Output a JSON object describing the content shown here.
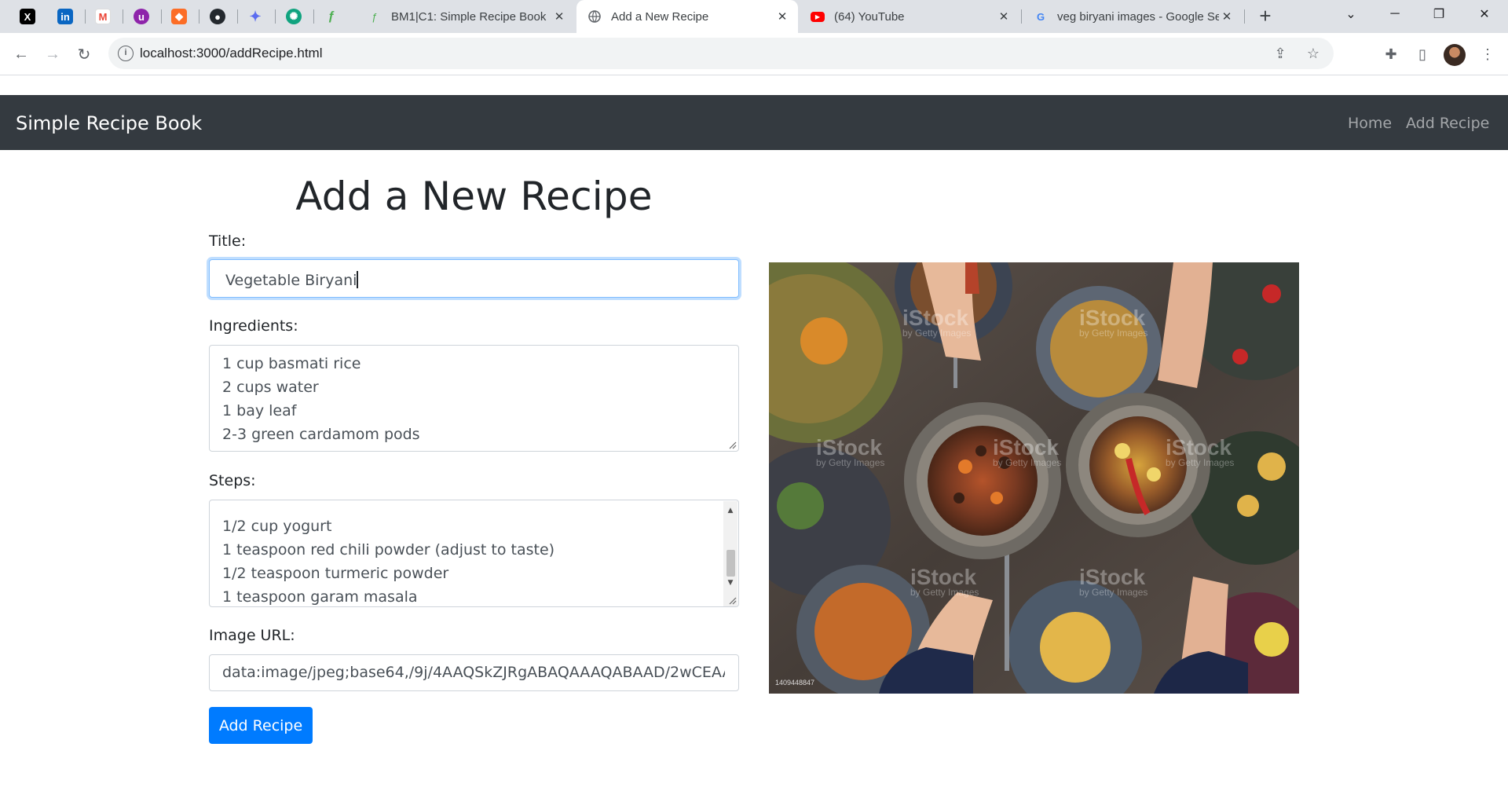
{
  "browser": {
    "tabs": [
      {
        "label": "BM1|C1: Simple Recipe Book"
      },
      {
        "label": "Add a New Recipe"
      },
      {
        "label": "(64) YouTube"
      },
      {
        "label": "veg biryani images - Google Se"
      }
    ],
    "address": "localhost:3000/addRecipe.html"
  },
  "navbar": {
    "brand": "Simple Recipe Book",
    "links": [
      "Home",
      "Add Recipe"
    ]
  },
  "form": {
    "heading": "Add a New Recipe",
    "title_label": "Title:",
    "title_value": "Vegetable Biryani",
    "ingredients_label": "Ingredients:",
    "ingredients_lines": [
      "1 cup basmati rice",
      "2 cups water",
      "1 bay leaf",
      "2-3 green cardamom pods"
    ],
    "steps_label": "Steps:",
    "steps_lines": [
      "1/2 cup yogurt",
      "1 teaspoon red chili powder (adjust to taste)",
      "1/2 teaspoon turmeric powder",
      "1 teaspoon garam masala"
    ],
    "image_url_label": "Image URL:",
    "image_url_value": "data:image/jpeg;base64,/9j/4AAQSkZJRgABAQAAAQABAAD/2wCEAAoGBxMTEhUTExM",
    "submit_label": "Add Recipe"
  },
  "photo": {
    "watermark": "iStock",
    "watermark_sub": "by Getty Images",
    "stock_id": "1409448847"
  },
  "colors": {
    "navbar_bg": "#343a40",
    "button_bg": "#007bff",
    "tab_strip": "#dee1e6"
  }
}
